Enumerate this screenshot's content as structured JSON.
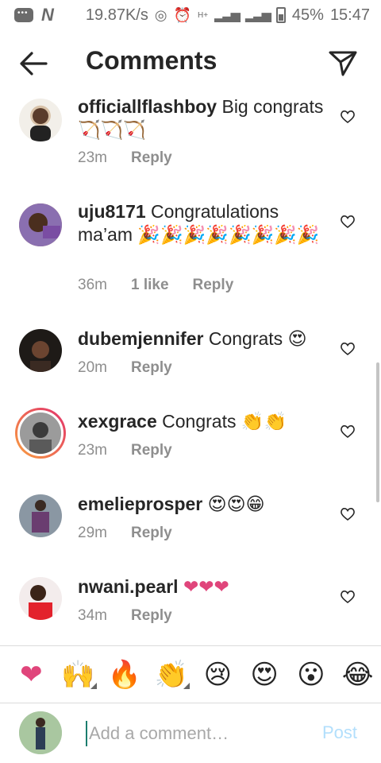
{
  "status_bar": {
    "speed": "19.87K/s",
    "network_badge": "H+",
    "battery": "45%",
    "time": "15:47"
  },
  "header": {
    "title": "Comments"
  },
  "comments": [
    {
      "username": "officiallflashboy",
      "text": "Big congrats 🏹🏹🏹",
      "time": "23m",
      "likes": "",
      "reply": "Reply"
    },
    {
      "username": "uju8171",
      "text": "Congratulations ma’am 🎉🎉🎉🎉🎉🎉🎉🎉",
      "time": "36m",
      "likes": "1 like",
      "reply": "Reply"
    },
    {
      "username": "dubemjennifer",
      "text": "Congrats 😍",
      "time": "20m",
      "likes": "",
      "reply": "Reply"
    },
    {
      "username": "xexgrace",
      "text": "Congrats 👏👏",
      "time": "23m",
      "likes": "",
      "reply": "Reply"
    },
    {
      "username": "emelieprosper",
      "text": "😍😍😁",
      "time": "29m",
      "likes": "",
      "reply": "Reply"
    },
    {
      "username": "nwani.pearl",
      "text": "❤❤❤",
      "time": "34m",
      "likes": "",
      "reply": "Reply"
    }
  ],
  "quick_emojis": [
    "❤",
    "🙌",
    "🔥",
    "👏",
    "😢",
    "😍",
    "😮",
    "😂"
  ],
  "composer": {
    "placeholder": "Add a comment…",
    "post_label": "Post"
  },
  "colors": {
    "heart_emoji": "#e0457b",
    "post_disabled": "#b2dffc",
    "meta_text": "#8e8e8e"
  }
}
